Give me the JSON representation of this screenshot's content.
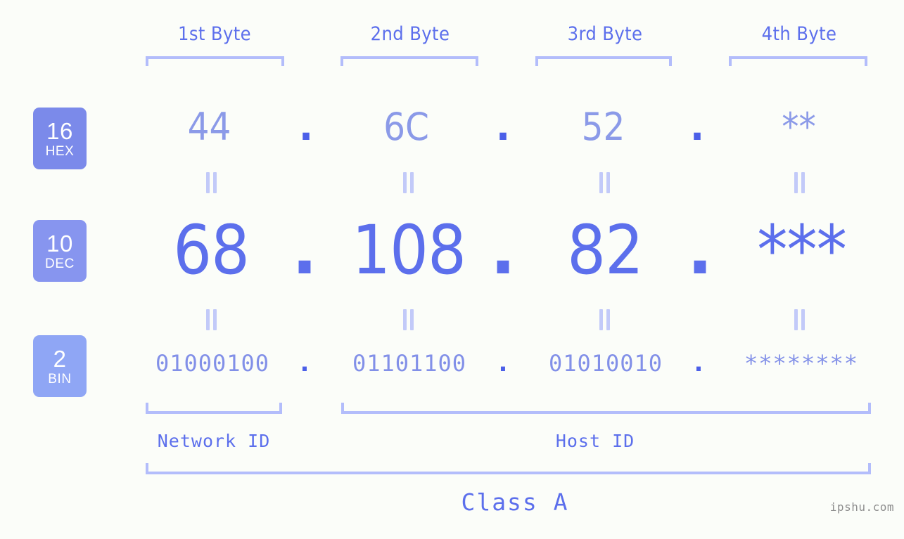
{
  "background_color": "#fbfdf9",
  "accent_colors": {
    "bracket": "#b3bdfb",
    "equal_mark": "#c2caf9",
    "hex_text": "#8b9ae8",
    "dec_text": "#5c6fec",
    "bin_text": "#8290e8",
    "separator_dot": "#4b5fe8",
    "badge_hex": "#7b8aea",
    "badge_dec": "#8795ef",
    "badge_bin": "#8fa6f5",
    "label_text": "#5c6fec",
    "watermark_text": "#8e8e8e"
  },
  "byte_headers": [
    {
      "label": "1st Byte"
    },
    {
      "label": "2nd Byte"
    },
    {
      "label": "3rd Byte"
    },
    {
      "label": "4th Byte"
    }
  ],
  "radix_badges": [
    {
      "number": "16",
      "unit": "HEX"
    },
    {
      "number": "10",
      "unit": "DEC"
    },
    {
      "number": "2",
      "unit": "BIN"
    }
  ],
  "separator": ".",
  "rows": {
    "hex": {
      "values": [
        "44",
        "6C",
        "52",
        "**"
      ]
    },
    "dec": {
      "values": [
        "68",
        "108",
        "82",
        "***"
      ]
    },
    "bin": {
      "values": [
        "01000100",
        "01101100",
        "01010010",
        "********"
      ]
    }
  },
  "sections": {
    "network_id": "Network ID",
    "host_id": "Host ID",
    "class": "Class A"
  },
  "watermark": "ipshu.com"
}
